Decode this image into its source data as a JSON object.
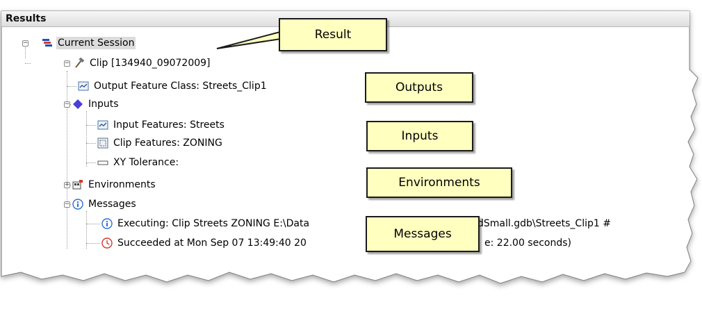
{
  "panel": {
    "title": "Results"
  },
  "tree": {
    "session": "Current Session",
    "tool": "Clip [134940_09072009]",
    "output_feature": "Output Feature Class: Streets_Clip1",
    "inputs": "Inputs",
    "input_features": "Input Features: Streets",
    "clip_features": "Clip Features: ZONING",
    "xy_tolerance": "XY Tolerance:",
    "environments": "Environments",
    "messages": "Messages",
    "msg_executing": "Executing: Clip Streets ZONING E:\\Data",
    "msg_executing_tail": "dSmall.gdb\\Streets_Clip1 #",
    "msg_succeeded": "Succeeded at Mon Sep 07 13:49:40 20",
    "msg_succeeded_tail": "e: 22.00 seconds)"
  },
  "callouts": {
    "result": "Result",
    "outputs": "Outputs",
    "inputs": "Inputs",
    "environments": "Environments",
    "messages": "Messages"
  },
  "colors": {
    "callout_fill": "#ffffc0",
    "selection": "#dcdcdc",
    "inputs_diamond": "#4a3fd6",
    "info_blue": "#2a6fd8",
    "clock_red": "#d23a2a"
  }
}
